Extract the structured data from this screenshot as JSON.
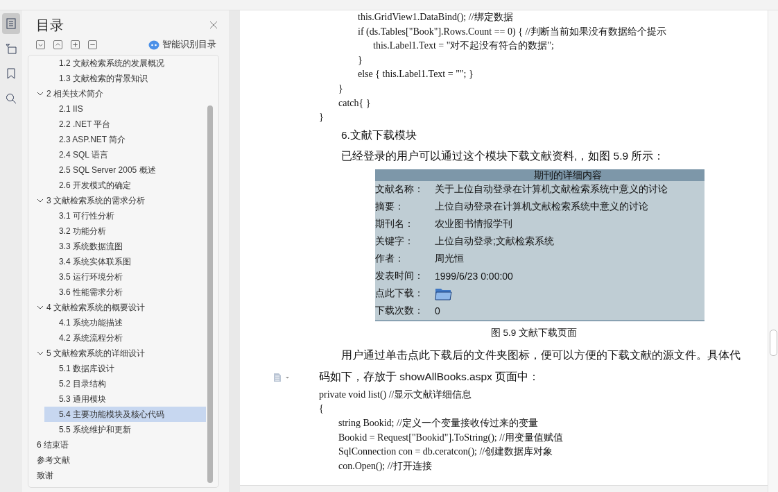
{
  "rail": [
    {
      "kind": "toc",
      "selected": true
    },
    {
      "kind": "outline",
      "selected": false
    },
    {
      "kind": "bookmark",
      "selected": false
    },
    {
      "kind": "search",
      "selected": false
    }
  ],
  "panel": {
    "title": "目录",
    "tools": [
      {
        "kind": "down"
      },
      {
        "kind": "up"
      },
      {
        "kind": "plus"
      },
      {
        "kind": "minus"
      }
    ],
    "smart_label": "智能识别目录",
    "tree": [
      {
        "children": [
          {
            "label": "1.2  文献检索系统的发展概况",
            "selected": false
          },
          {
            "label": "1.3  文献检索的背景知识",
            "selected": false
          }
        ]
      },
      {
        "label": "2  相关技术简介",
        "expanded": true,
        "selected": false,
        "children": [
          {
            "label": "2.1 IIS",
            "selected": false
          },
          {
            "label": "2.2 .NET 平台",
            "selected": false
          },
          {
            "label": "2.3 ASP.NET  简介",
            "selected": false
          },
          {
            "label": "2.4 SQL 语言",
            "selected": false
          },
          {
            "label": "2.5 SQL Server 2005  概述",
            "selected": false
          },
          {
            "label": "2.6  开发模式的确定",
            "selected": false
          }
        ]
      },
      {
        "label": "3  文献检索系统的需求分析",
        "expanded": true,
        "selected": false,
        "children": [
          {
            "label": "3.1  可行性分析",
            "selected": false
          },
          {
            "label": "3.2  功能分析",
            "selected": false
          },
          {
            "label": "3.3  系统数据流图",
            "selected": false
          },
          {
            "label": "3.4  系统实体联系图",
            "selected": false
          },
          {
            "label": "3.5  运行环境分析",
            "selected": false
          },
          {
            "label": "3.6  性能需求分析",
            "selected": false
          }
        ]
      },
      {
        "label": "4 文献检索系统的概要设计",
        "expanded": true,
        "selected": false,
        "children": [
          {
            "label": "4.1  系统功能描述",
            "selected": false
          },
          {
            "label": "4.2  系统流程分析",
            "selected": false
          }
        ]
      },
      {
        "label": "5  文献检索系统的详细设计",
        "expanded": true,
        "selected": false,
        "children": [
          {
            "label": "5.1  数据库设计",
            "selected": false
          },
          {
            "label": "5.2  目录结构",
            "selected": false
          },
          {
            "label": "5.3  通用模块",
            "selected": false
          },
          {
            "label": "5.4  主要功能模块及核心代码",
            "selected": true
          },
          {
            "label": "5.5  系统维护和更新",
            "selected": false
          }
        ]
      },
      {
        "label": "6  结束语",
        "selected": false
      },
      {
        "label": "参考文献",
        "selected": false
      },
      {
        "label": "致谢",
        "selected": false
      }
    ]
  },
  "document": [
    {
      "kind": "code3",
      "text": "this.GridView1.DataBind(); //绑定数据"
    },
    {
      "kind": "code3",
      "text": "if (ds.Tables[\"Book\"].Rows.Count == 0) { //判断当前如果没有数据给个提示"
    },
    {
      "kind": "code4",
      "text": "this.Label1.Text = \"对不起没有符合的数据\";"
    },
    {
      "kind": "code3",
      "text": "}"
    },
    {
      "kind": "code3",
      "text": "else { this.Label1.Text = \"\"; }"
    },
    {
      "kind": "code2",
      "text": "}"
    },
    {
      "kind": "code2",
      "text": "catch{ }"
    },
    {
      "kind": "code",
      "text": "}"
    },
    {
      "kind": "heading",
      "text": "6.文献下载模块"
    },
    {
      "kind": "para",
      "lines": [
        "已经登录的用户可以通过这个模块下载文献资料,，如图 5.9 所示："
      ],
      "marker": false
    },
    {
      "kind": "figure",
      "header": "期刊的详细内容",
      "rows": [
        {
          "kind": "text",
          "label": "文献名称：",
          "value": "关于上位自动登录在计算机文献检索系统中意义的讨论"
        },
        {
          "kind": "text",
          "label": "摘要：",
          "value": "上位自动登录在计算机文献检索系统中意义的讨论"
        },
        {
          "kind": "text",
          "label": "期刊名：",
          "value": "农业图书情报学刊"
        },
        {
          "kind": "text",
          "label": "关键字：",
          "value": "上位自动登录;文献检索系统"
        },
        {
          "kind": "text",
          "label": "作者：",
          "value": "周光恒"
        },
        {
          "kind": "text",
          "label": "发表时间：",
          "value": "1999/6/23 0:00:00"
        },
        {
          "kind": "download",
          "label": "点此下载："
        },
        {
          "kind": "text",
          "label": "下载次数：",
          "value": "0"
        }
      ]
    },
    {
      "kind": "caption",
      "text": "图 5.9  文献下载页面"
    },
    {
      "kind": "para",
      "lines": [
        "用户通过单击点此下载后的文件夹图标，便可以方便的下载文献的源文件。具体代",
        "码如下，存放于 showAllBooks.aspx 页面中："
      ],
      "marker": true
    },
    {
      "kind": "code",
      "text": "private void list() //显示文献详细信息"
    },
    {
      "kind": "code",
      "text": "{"
    },
    {
      "kind": "code2",
      "text": "string Bookid; //定义一个变量接收传过来的变量"
    },
    {
      "kind": "code2",
      "text": "Bookid = Request[\"Bookid\"].ToString(); //用变量值赋值"
    },
    {
      "kind": "code2",
      "text": "SqlConnection con = db.ceratcon(); //创建数据库对象"
    },
    {
      "kind": "code2",
      "text": "con.Open(); //打开连接"
    }
  ]
}
